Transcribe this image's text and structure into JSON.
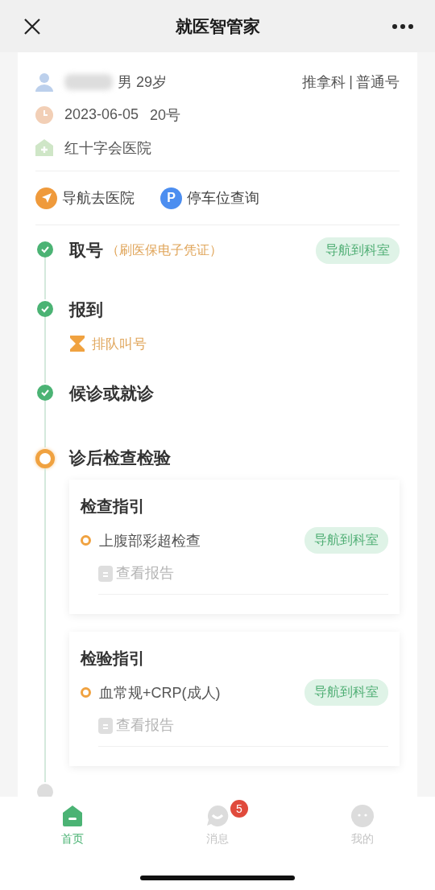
{
  "header": {
    "title": "就医智管家"
  },
  "patient": {
    "gender_age": "男 29岁",
    "department": "推拿科",
    "separator": "|",
    "ticket_type": "普通号",
    "date": "2023-06-05",
    "number": "20号",
    "hospital": "红十字会医院"
  },
  "actions": [
    {
      "kind": "navigate",
      "label": "导航去医院"
    },
    {
      "kind": "parking",
      "icon": "P",
      "label": "停车位查询"
    }
  ],
  "steps": [
    {
      "done": true,
      "current": false,
      "title": "取号",
      "note": "（刷医保电子凭证）",
      "button": "导航到科室"
    },
    {
      "done": true,
      "current": false,
      "title": "报到",
      "sub": "排队叫号"
    },
    {
      "done": true,
      "current": false,
      "title": "候诊或就诊"
    },
    {
      "done": false,
      "current": true,
      "title": "诊后检查检验",
      "cards": [
        {
          "title": "检查指引",
          "items": [
            {
              "name": "上腹部彩超检查",
              "button": "导航到科室",
              "report": "查看报告"
            }
          ]
        },
        {
          "title": "检验指引",
          "items": [
            {
              "name": "血常规+CRP(成人)",
              "button": "导航到科室",
              "report": "查看报告"
            }
          ]
        }
      ]
    },
    {
      "done": false,
      "current": false
    }
  ],
  "tabbar": [
    {
      "kind": "home",
      "label": "首页",
      "selected": true
    },
    {
      "kind": "message",
      "label": "消息",
      "selected": false,
      "badge": "5"
    },
    {
      "kind": "profile",
      "label": "我的",
      "selected": false
    }
  ]
}
